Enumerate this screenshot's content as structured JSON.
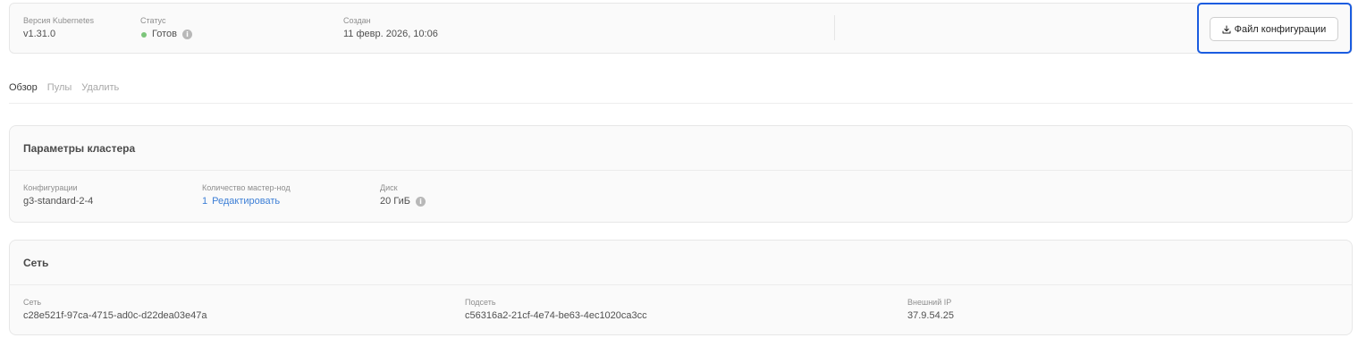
{
  "header": {
    "k8s_version": {
      "label": "Версия Kubernetes",
      "value": "v1.31.0"
    },
    "status": {
      "label": "Статус",
      "value": "Готов",
      "color": "#7cc57a"
    },
    "created": {
      "label": "Создан",
      "value": "11 февр. 2026, 10:06"
    },
    "config_button_label": "Файл конфигурации"
  },
  "tabs": [
    {
      "label": "Обзор",
      "active": true
    },
    {
      "label": "Пулы",
      "active": false
    },
    {
      "label": "Удалить",
      "active": false
    }
  ],
  "cluster_params": {
    "title": "Параметры кластера",
    "configuration": {
      "label": "Конфигурации",
      "value": "g3-standard-2-4"
    },
    "master_nodes": {
      "label": "Количество мастер-нод",
      "value": "1",
      "edit_label": "Редактировать"
    },
    "disk": {
      "label": "Диск",
      "value": "20 ГиБ"
    }
  },
  "network": {
    "title": "Сеть",
    "net": {
      "label": "Сеть",
      "value": "c28e521f-97ca-4715-ad0c-d22dea03e47a"
    },
    "subnet": {
      "label": "Подсеть",
      "value": "c56316a2-21cf-4e74-be63-4ec1020ca3cc"
    },
    "external_ip": {
      "label": "Внешний IP",
      "value": "37.9.54.25"
    }
  },
  "colors": {
    "accent": "#1a5ce0",
    "link": "#3d7fd6"
  }
}
